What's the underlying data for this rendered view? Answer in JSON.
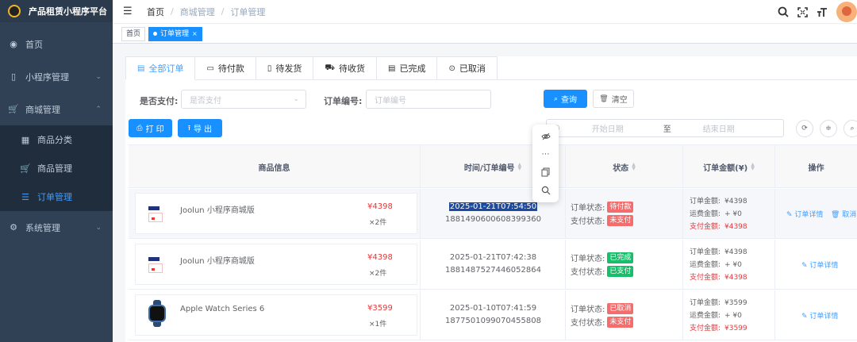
{
  "app": {
    "title": "产品租赁小程序平台"
  },
  "sidebar": {
    "items": [
      {
        "label": "首页",
        "icon": "dashboard-icon",
        "glyph": "◉"
      },
      {
        "label": "小程序管理",
        "icon": "phone-icon",
        "glyph": "▯",
        "arrow": "⌄"
      },
      {
        "label": "商城管理",
        "icon": "cart-icon",
        "glyph": "🛒",
        "arrow": "⌃"
      },
      {
        "label": "系统管理",
        "icon": "gear-icon",
        "glyph": "⚙",
        "arrow": "⌄"
      }
    ],
    "sub_items": [
      {
        "label": "商品分类",
        "icon": "grid-icon",
        "glyph": "▦"
      },
      {
        "label": "商品管理",
        "icon": "cart-icon",
        "glyph": "🛒"
      },
      {
        "label": "订单管理",
        "icon": "list-icon",
        "glyph": "☰"
      }
    ]
  },
  "navbar": {
    "breadcrumb": [
      "首页",
      "商城管理",
      "订单管理"
    ],
    "sep": "/"
  },
  "tags": {
    "home": "首页",
    "active": "订单管理",
    "close": "×"
  },
  "tabs": [
    {
      "label": "全部订单",
      "icon": "▤"
    },
    {
      "label": "待付款",
      "icon": "▭"
    },
    {
      "label": "待发货",
      "icon": "▯"
    },
    {
      "label": "待收货",
      "icon": "⛟"
    },
    {
      "label": "已完成",
      "icon": "▤"
    },
    {
      "label": "已取消",
      "icon": "⊙"
    }
  ],
  "filters": {
    "paid_label": "是否支付:",
    "paid_placeholder": "是否支付",
    "order_no_label": "订单编号:",
    "order_no_placeholder": "订单编号",
    "search_btn": "查询",
    "clear_btn": "清空",
    "print_btn": "打 印",
    "export_btn": "导 出",
    "start_date": "开始日期",
    "to": "至",
    "end_date": "结束日期"
  },
  "table": {
    "headers": [
      "商品信息",
      "时间/订单编号",
      "状态",
      "订单金额(¥)",
      "操作"
    ],
    "status_labels": {
      "order": "订单状态:",
      "pay": "支付状态:"
    },
    "amount_labels": {
      "order": "订单金额:",
      "shipping": "运费金额:",
      "paid": "支付金额:"
    },
    "rows": [
      {
        "name": "Joolun 小程序商城版",
        "price": "¥4398",
        "qty": "×2件",
        "time": "2025-01-21T07:54:50",
        "order_no": "1881490600608399360",
        "order_status": "待付款",
        "order_status_color": "#f56c6c",
        "pay_status": "未支付",
        "pay_status_color": "#f56c6c",
        "order_amount": "¥4398",
        "shipping": "+ ¥0",
        "paid_amount": "¥4398",
        "actions": [
          "订单详情",
          "取消"
        ]
      },
      {
        "name": "Joolun 小程序商城版",
        "price": "¥4398",
        "qty": "×2件",
        "time": "2025-01-21T07:42:38",
        "order_no": "1881487527446052864",
        "order_status": "已完成",
        "order_status_color": "#19be6b",
        "pay_status": "已支付",
        "pay_status_color": "#19be6b",
        "order_amount": "¥4398",
        "shipping": "+ ¥0",
        "paid_amount": "¥4398",
        "actions": [
          "订单详情"
        ]
      },
      {
        "name": "Apple Watch Series 6",
        "price": "¥3599",
        "qty": "×1件",
        "time": "2025-01-10T07:41:59",
        "order_no": "1877501099070455808",
        "order_status": "已取消",
        "order_status_color": "#f56c6c",
        "pay_status": "未支付",
        "pay_status_color": "#f56c6c",
        "order_amount": "¥3599",
        "shipping": "+ ¥0",
        "paid_amount": "¥3599",
        "actions": [
          "订单详情"
        ]
      }
    ]
  },
  "float_toolbar": [
    "eye-off-icon",
    "more-icon",
    "copy-icon",
    "search-icon"
  ]
}
